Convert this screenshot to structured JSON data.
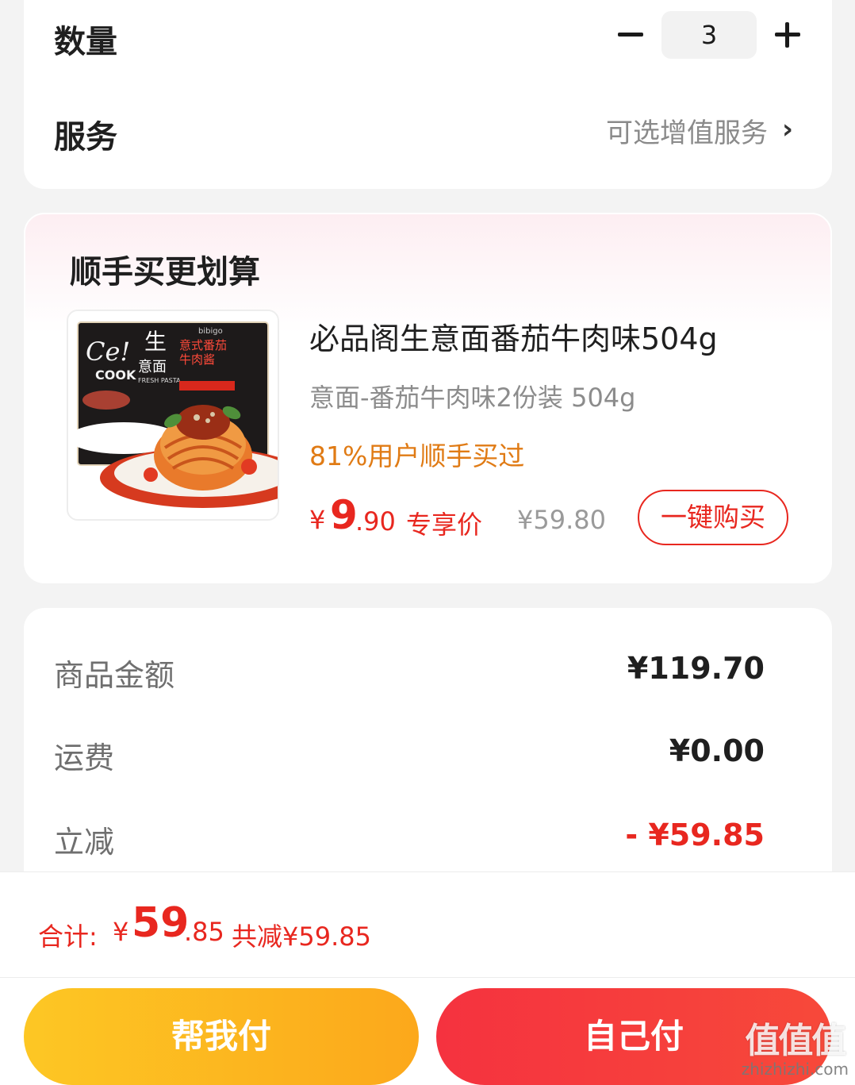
{
  "quantity": {
    "label": "数量",
    "value": "3"
  },
  "service": {
    "label": "服务",
    "hint": "可选增值服务",
    "chevron": "›"
  },
  "upsell": {
    "title": "顺手买更划算",
    "product": {
      "name": "必品阁生意面番茄牛肉味504g",
      "spec": "意面-番茄牛肉味2份装 504g",
      "stat": "81%用户顺手买过",
      "price_symbol": "¥",
      "price_int": "9",
      "price_dec": ".90",
      "price_tag": "专享价",
      "original_price": "¥59.80",
      "buy_label": "一键购买",
      "image": {
        "brand": "bibigo",
        "logo": "Ce! COOK",
        "headline_1": "生",
        "headline_2": "意面",
        "subtitle": "FRESH PASTA",
        "flavor": "意式番茄牛肉酱"
      }
    }
  },
  "summary": {
    "rows": [
      {
        "label": "商品金额",
        "value": "¥119.70"
      },
      {
        "label": "运费",
        "value": "¥0.00"
      },
      {
        "label": "立减",
        "value": "- ¥59.85"
      }
    ]
  },
  "footer": {
    "total_label": "合计:",
    "total_symbol": "¥",
    "total_int": "59",
    "total_dec": ".85",
    "total_saved": "共减¥59.85",
    "help_pay_label": "帮我付",
    "self_pay_label": "自己付"
  },
  "watermark": {
    "glyphs": "值值值",
    "url": "zhizhizhi.com"
  },
  "colors": {
    "accent_red": "#e8271f",
    "accent_orange": "#e07b15",
    "help_btn_start": "#fdc724",
    "help_btn_end": "#fca81b",
    "self_btn_start": "#f5323f",
    "self_btn_end": "#f7493a"
  }
}
